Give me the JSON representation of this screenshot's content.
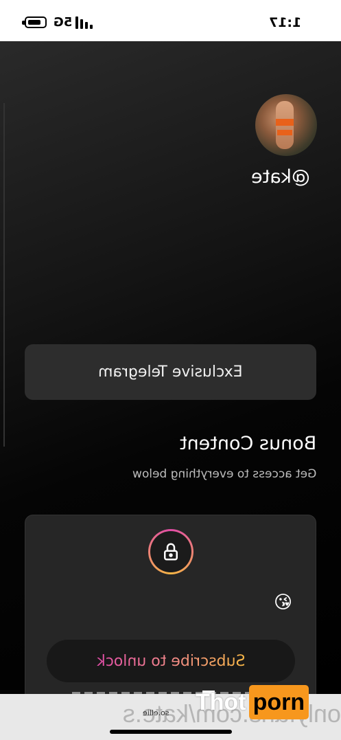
{
  "status": {
    "time": "1:17",
    "network": "5G"
  },
  "profile": {
    "username": "@kate",
    "avatar_icon": "profile-photo"
  },
  "links": {
    "telegram_label": "Exclusive Telegram"
  },
  "bonus": {
    "title": "Bonus Content",
    "subtitle": "Get access to everything below"
  },
  "locked": {
    "lock_icon": "lock-icon",
    "emoji": "😘",
    "subscribe_label": "Subscribe to unlock"
  },
  "browser": {
    "url": "onlyfans.com/kate.s",
    "small_text": "so.ellie"
  },
  "watermark": {
    "part1": "Thot",
    "part2": "porn"
  },
  "colors": {
    "accent_pink": "#e04ca6",
    "accent_gold": "#f6b645",
    "watermark_orange": "#f7971d"
  }
}
